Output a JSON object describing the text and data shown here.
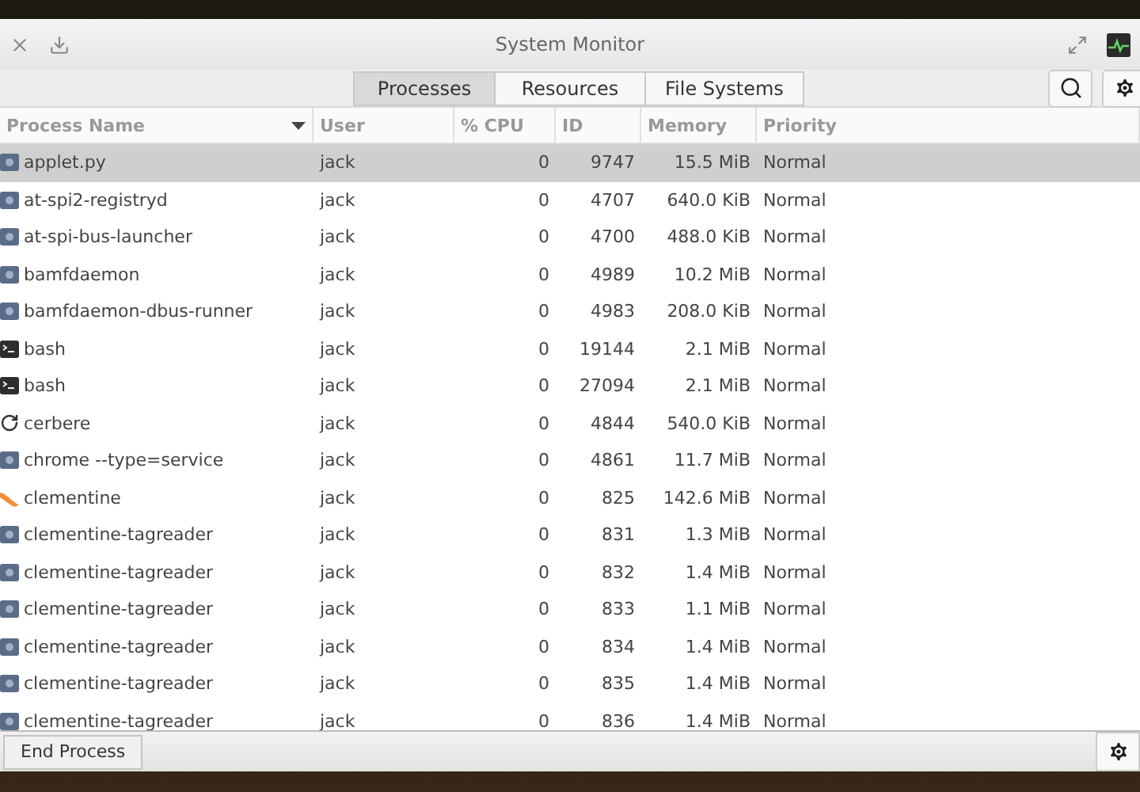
{
  "window": {
    "title": "System Monitor"
  },
  "tabs": [
    {
      "label": "Processes",
      "selected": true
    },
    {
      "label": "Resources",
      "selected": false
    },
    {
      "label": "File Systems",
      "selected": false
    }
  ],
  "table": {
    "columns": [
      {
        "label": "Process Name",
        "sorted": true
      },
      {
        "label": "User",
        "sorted": false
      },
      {
        "label": "% CPU",
        "sorted": false
      },
      {
        "label": "ID",
        "sorted": false
      },
      {
        "label": "Memory",
        "sorted": false
      },
      {
        "label": "Priority",
        "sorted": false
      }
    ],
    "rows": [
      {
        "kind": "generic",
        "name": "applet.py",
        "user": "jack",
        "cpu": "0",
        "id": "9747",
        "memory": "15.5 MiB",
        "priority": "Normal",
        "selected": true
      },
      {
        "kind": "generic",
        "name": "at-spi2-registryd",
        "user": "jack",
        "cpu": "0",
        "id": "4707",
        "memory": "640.0 KiB",
        "priority": "Normal",
        "selected": false
      },
      {
        "kind": "generic",
        "name": "at-spi-bus-launcher",
        "user": "jack",
        "cpu": "0",
        "id": "4700",
        "memory": "488.0 KiB",
        "priority": "Normal",
        "selected": false
      },
      {
        "kind": "generic",
        "name": "bamfdaemon",
        "user": "jack",
        "cpu": "0",
        "id": "4989",
        "memory": "10.2 MiB",
        "priority": "Normal",
        "selected": false
      },
      {
        "kind": "generic",
        "name": "bamfdaemon-dbus-runner",
        "user": "jack",
        "cpu": "0",
        "id": "4983",
        "memory": "208.0 KiB",
        "priority": "Normal",
        "selected": false
      },
      {
        "kind": "terminal",
        "name": "bash",
        "user": "jack",
        "cpu": "0",
        "id": "19144",
        "memory": "2.1 MiB",
        "priority": "Normal",
        "selected": false
      },
      {
        "kind": "terminal",
        "name": "bash",
        "user": "jack",
        "cpu": "0",
        "id": "27094",
        "memory": "2.1 MiB",
        "priority": "Normal",
        "selected": false
      },
      {
        "kind": "refresh",
        "name": "cerbere",
        "user": "jack",
        "cpu": "0",
        "id": "4844",
        "memory": "540.0 KiB",
        "priority": "Normal",
        "selected": false
      },
      {
        "kind": "generic",
        "name": "chrome --type=service",
        "user": "jack",
        "cpu": "0",
        "id": "4861",
        "memory": "11.7 MiB",
        "priority": "Normal",
        "selected": false
      },
      {
        "kind": "fruit",
        "name": "clementine",
        "user": "jack",
        "cpu": "0",
        "id": "825",
        "memory": "142.6 MiB",
        "priority": "Normal",
        "selected": false
      },
      {
        "kind": "generic",
        "name": "clementine-tagreader",
        "user": "jack",
        "cpu": "0",
        "id": "831",
        "memory": "1.3 MiB",
        "priority": "Normal",
        "selected": false
      },
      {
        "kind": "generic",
        "name": "clementine-tagreader",
        "user": "jack",
        "cpu": "0",
        "id": "832",
        "memory": "1.4 MiB",
        "priority": "Normal",
        "selected": false
      },
      {
        "kind": "generic",
        "name": "clementine-tagreader",
        "user": "jack",
        "cpu": "0",
        "id": "833",
        "memory": "1.1 MiB",
        "priority": "Normal",
        "selected": false
      },
      {
        "kind": "generic",
        "name": "clementine-tagreader",
        "user": "jack",
        "cpu": "0",
        "id": "834",
        "memory": "1.4 MiB",
        "priority": "Normal",
        "selected": false
      },
      {
        "kind": "generic",
        "name": "clementine-tagreader",
        "user": "jack",
        "cpu": "0",
        "id": "835",
        "memory": "1.4 MiB",
        "priority": "Normal",
        "selected": false
      },
      {
        "kind": "generic",
        "name": "clementine-tagreader",
        "user": "jack",
        "cpu": "0",
        "id": "836",
        "memory": "1.4 MiB",
        "priority": "Normal",
        "selected": false
      }
    ]
  },
  "bottom_bar": {
    "button": "End Process"
  }
}
